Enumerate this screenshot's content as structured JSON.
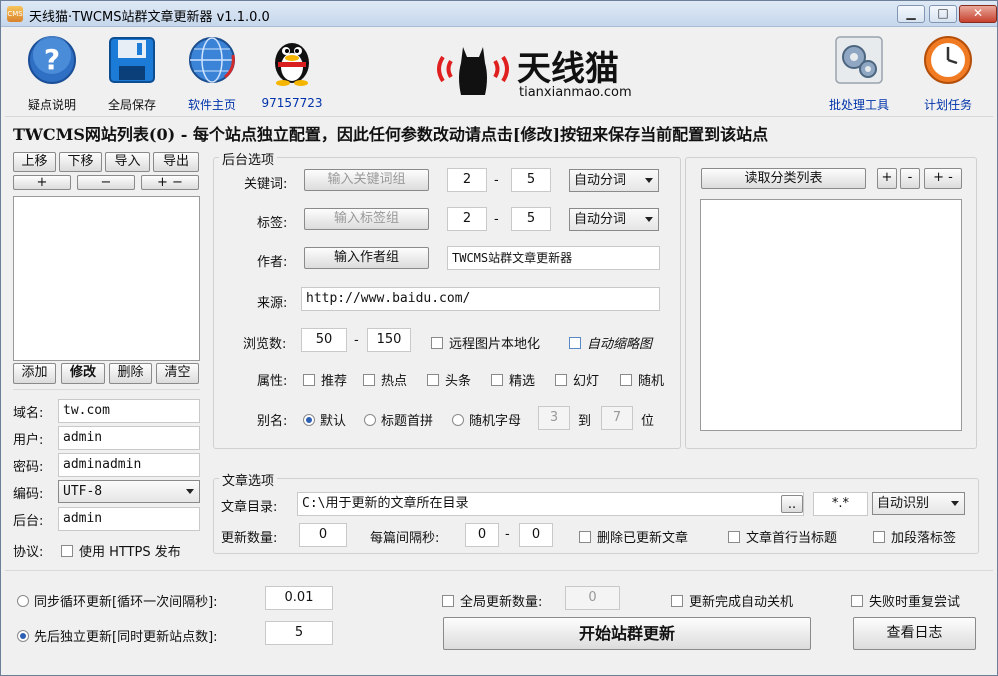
{
  "window": {
    "title": "天线猫·TWCMS站群文章更新器 v1.1.0.0",
    "icon_text": "CMS",
    "controls": {
      "minimize": "▁",
      "maximize": "□",
      "close": "✕"
    }
  },
  "toolbar": {
    "help": "疑点说明",
    "save_all": "全局保存",
    "homepage": "软件主页",
    "qq": "97157723",
    "batch": "批处理工具",
    "schedule": "计划任务"
  },
  "logo": {
    "name": "天线猫",
    "domain": "tianxianmao.com"
  },
  "site_list": {
    "header": "TWCMS网站列表(0) - 每个站点独立配置，因此任何参数改动请点击[修改]按钮来保存当前配置到该站点",
    "move_up": "上移",
    "move_down": "下移",
    "import": "导入",
    "export": "导出",
    "plus": "+",
    "minus": "−",
    "plus_minus": "+ −",
    "add": "添加",
    "edit": "修改",
    "delete": "删除",
    "clear": "清空"
  },
  "site_form": {
    "domain_label": "域名:",
    "domain_value": "tw.com",
    "user_label": "用户:",
    "user_value": "admin",
    "password_label": "密码:",
    "password_value": "adminadmin",
    "encoding_label": "编码:",
    "encoding_value": "UTF-8",
    "backend_label": "后台:",
    "backend_value": "admin",
    "protocol_label": "协议:",
    "https_label": "使用 HTTPS 发布"
  },
  "backend": {
    "title": "后台选项",
    "keywords_label": "关键词:",
    "keywords_button": "输入关键词组",
    "keywords_min": "2",
    "keywords_max": "5",
    "keywords_mode": "自动分词",
    "tags_label": "标签:",
    "tags_button": "输入标签组",
    "tags_min": "2",
    "tags_max": "5",
    "tags_mode": "自动分词",
    "author_label": "作者:",
    "author_button": "输入作者组",
    "author_value": "TWCMS站群文章更新器",
    "source_label": "来源:",
    "source_value": "http://www.baidu.com/",
    "views_label": "浏览数:",
    "views_min": "50",
    "views_max": "150",
    "dash": "-",
    "localize_images": "远程图片本地化",
    "auto_thumb": "自动缩略图",
    "attr_label": "属性:",
    "attrs": [
      "推荐",
      "热点",
      "头条",
      "精选",
      "幻灯",
      "随机"
    ],
    "alias_label": "别名:",
    "alias_default": "默认",
    "alias_pinyin": "标题首拼",
    "alias_random": "随机字母",
    "alias_min": "3",
    "alias_to": "到",
    "alias_max": "7",
    "alias_unit": "位"
  },
  "category": {
    "read_button": "读取分类列表",
    "plus": "+",
    "minus": "-",
    "plus_minus": "+ -"
  },
  "article": {
    "title": "文章选项",
    "dir_label": "文章目录:",
    "dir_value": "C:\\用于更新的文章所在目录",
    "browse": "..",
    "pattern": "*.*",
    "detect": "自动识别",
    "count_label": "更新数量:",
    "count_value": "0",
    "interval_label": "每篇间隔秒:",
    "interval_min": "0",
    "interval_max": "0",
    "delete_updated": "删除已更新文章",
    "first_line_title": "文章首行当标题",
    "add_paragraph": "加段落标签"
  },
  "bottom": {
    "sync_loop": "同步循环更新[循环一次间隔秒]:",
    "sync_value": "0.01",
    "sequential": "先后独立更新[同时更新站点数]:",
    "sequential_value": "5",
    "global_count": "全局更新数量:",
    "global_count_value": "0",
    "auto_shutdown": "更新完成自动关机",
    "retry": "失败时重复尝试",
    "start": "开始站群更新",
    "log": "查看日志"
  }
}
